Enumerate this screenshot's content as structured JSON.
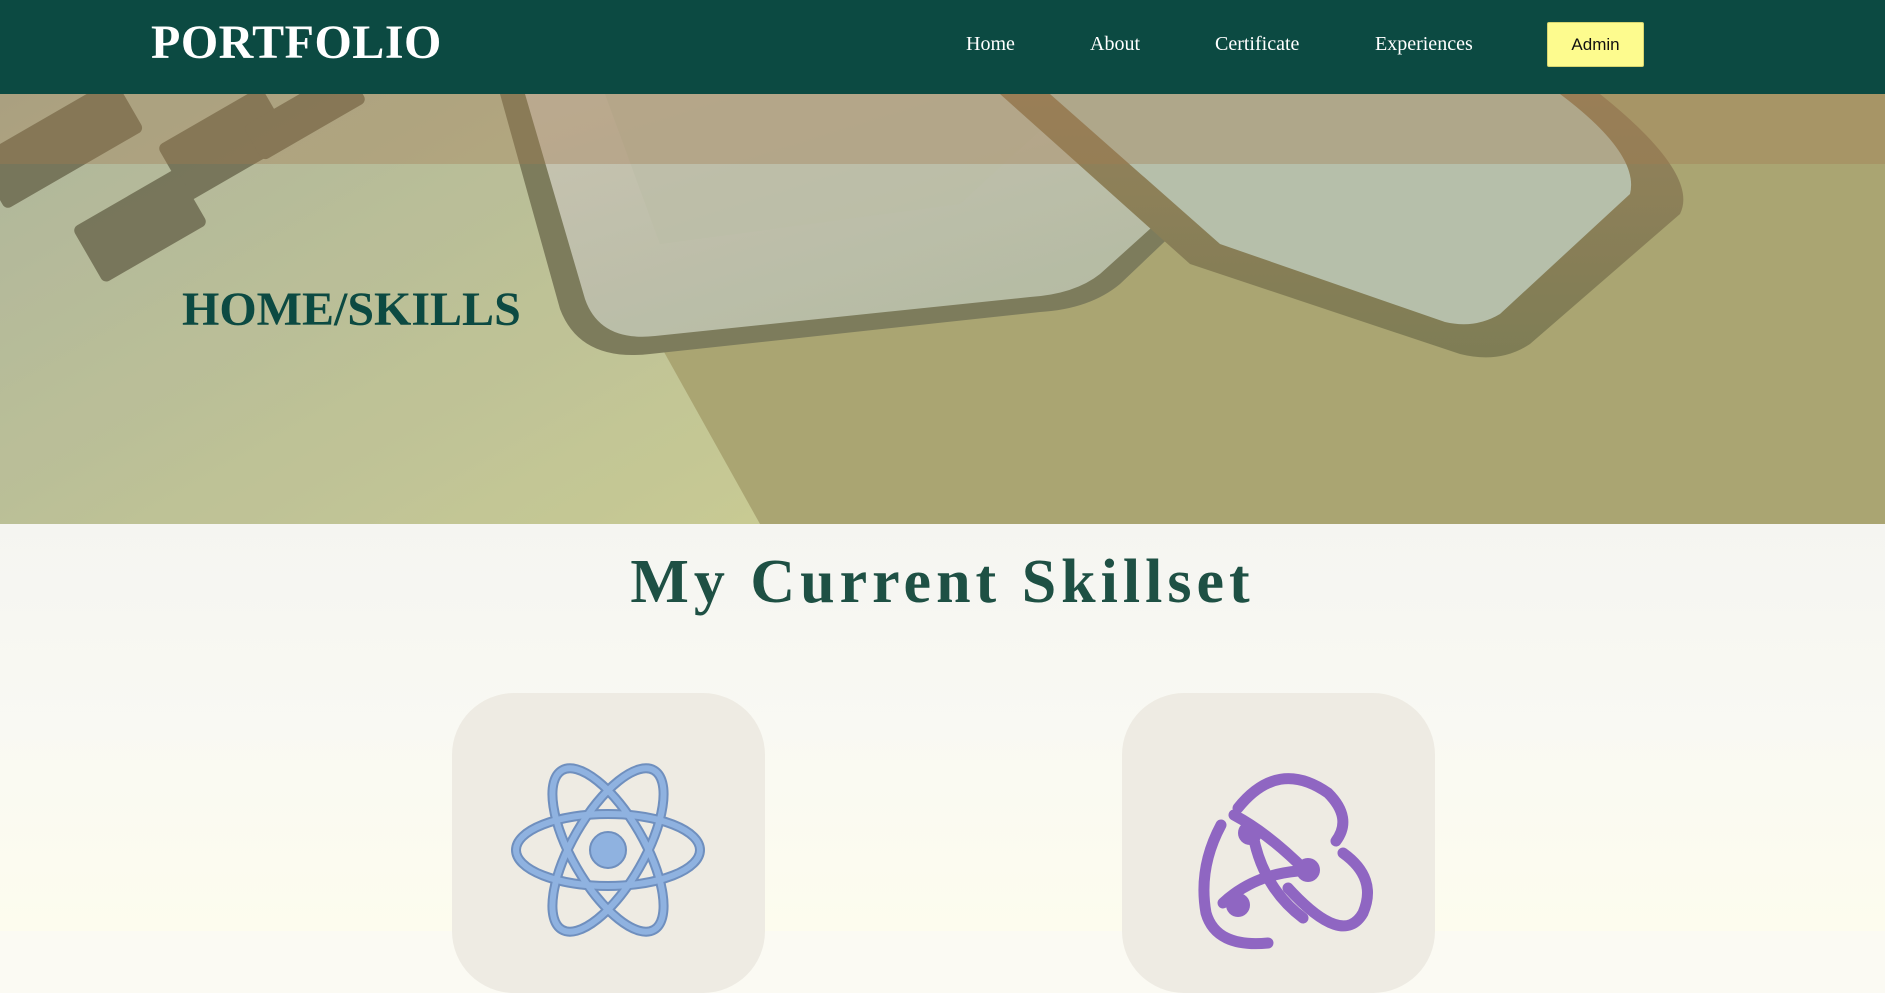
{
  "navbar": {
    "brand": "PORTFOLIO",
    "links": [
      "Home",
      "About",
      "Certificate",
      "Experiences"
    ],
    "admin_label": "Admin",
    "background": "#0c4a42",
    "admin_color": "#fdfb8e"
  },
  "hero": {
    "title": "HOME/SKILLS",
    "title_color": "#0c4a42"
  },
  "skills": {
    "title": "My Current Skillset",
    "title_color": "#1e5044",
    "cards": [
      {
        "icon": "react-icon",
        "color": "#8fb2e0"
      },
      {
        "icon": "redux-icon",
        "color": "#8f66c2"
      }
    ]
  }
}
